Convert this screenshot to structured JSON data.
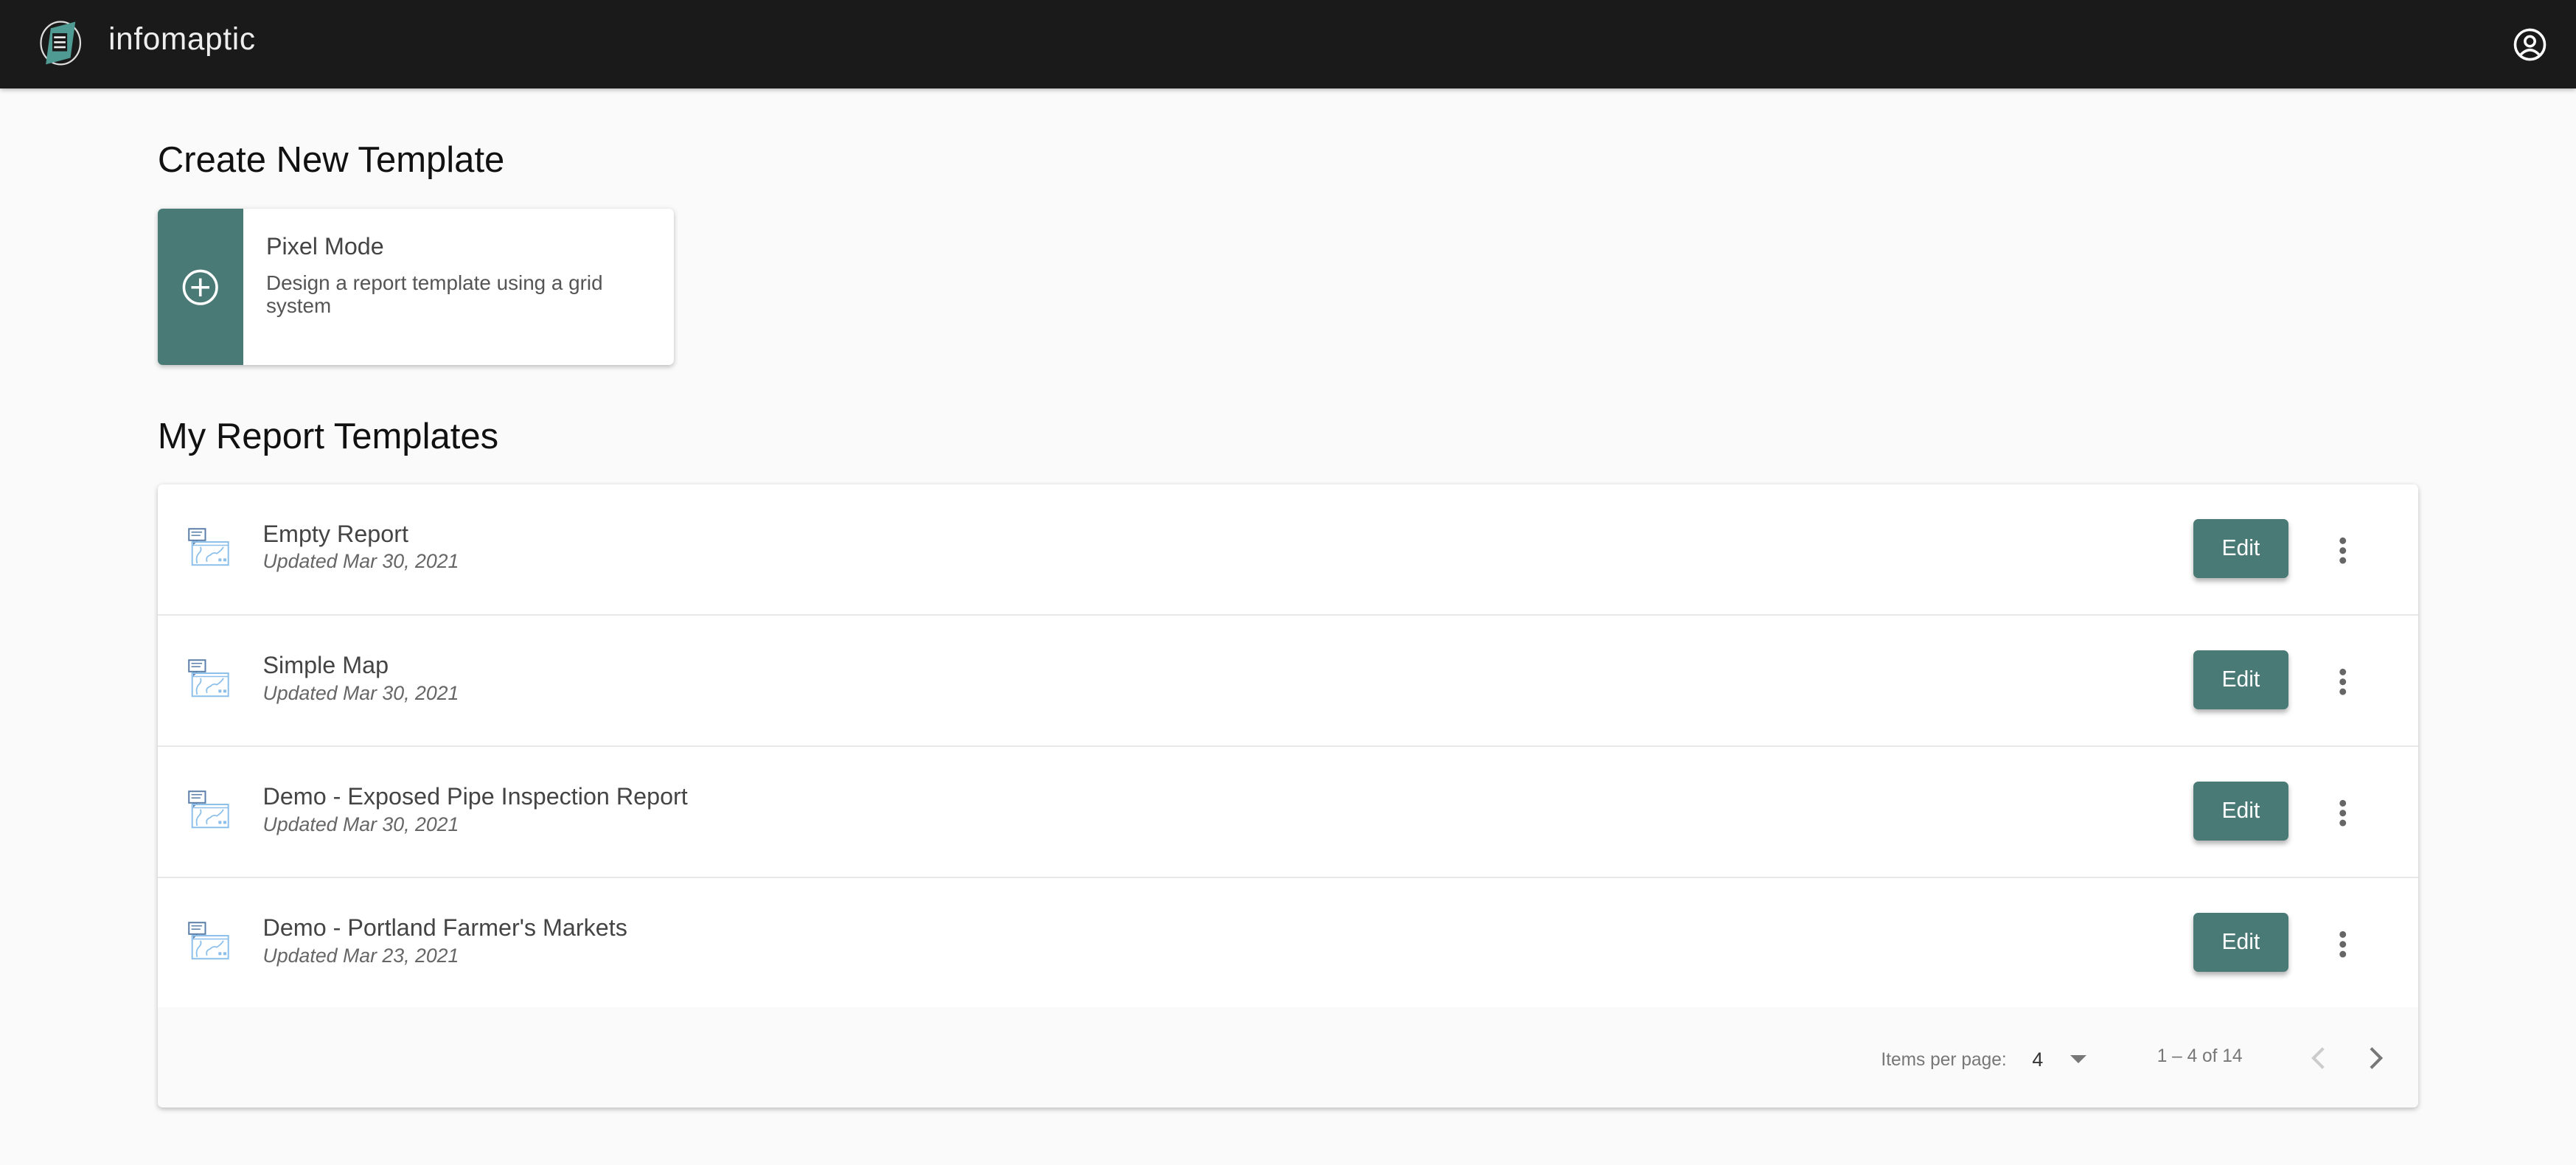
{
  "header": {
    "brand": "infomaptic",
    "logo_icon": "infomaptic-logo",
    "user_icon": "account-circle-icon"
  },
  "create": {
    "title": "Create New Template",
    "card": {
      "title": "Pixel Mode",
      "description": "Design a report template using a grid system",
      "icon": "plus-circle-icon",
      "accent": "#4a7a76"
    }
  },
  "templates": {
    "title": "My Report Templates",
    "items": [
      {
        "name": "Empty Report",
        "updated": "Updated Mar 30, 2021",
        "edit_label": "Edit"
      },
      {
        "name": "Simple Map",
        "updated": "Updated Mar 30, 2021",
        "edit_label": "Edit"
      },
      {
        "name": "Demo - Exposed Pipe Inspection Report",
        "updated": "Updated Mar 30, 2021",
        "edit_label": "Edit"
      },
      {
        "name": "Demo - Portland Farmer's Markets",
        "updated": "Updated Mar 23, 2021",
        "edit_label": "Edit"
      }
    ],
    "pagination": {
      "items_per_page_label": "Items per page:",
      "items_per_page": "4",
      "range": "1 – 4 of 14"
    }
  }
}
